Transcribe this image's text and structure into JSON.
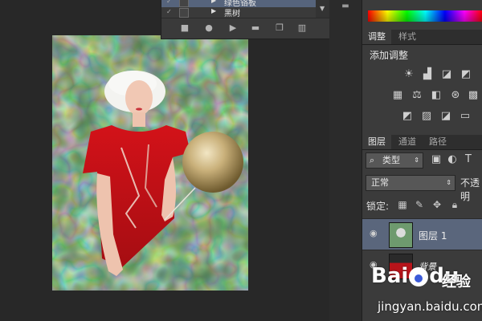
{
  "actions_panel": {
    "rows": [
      {
        "name": "绿色铬板"
      },
      {
        "name": "黑树"
      }
    ]
  },
  "adjustments": {
    "tabs": [
      {
        "label": "调整"
      },
      {
        "label": "样式"
      }
    ],
    "title": "添加调整"
  },
  "layers": {
    "tabs": [
      {
        "label": "图层"
      },
      {
        "label": "通道"
      },
      {
        "label": "路径"
      }
    ],
    "filter_kind": "类型",
    "blend_mode": "正常",
    "opacity_label": "不透明",
    "lock_label": "锁定:",
    "items": [
      {
        "name": "图层 1",
        "selected": true
      },
      {
        "name": "背景",
        "selected": false
      }
    ]
  },
  "watermark": {
    "brand": "Bai",
    "brand_end": "du",
    "name": "经验",
    "url": "jingyan.baidu.com"
  },
  "colors": {
    "selection": "#5a667c",
    "panel_bg": "#3b3b3b",
    "canvas_bg": "#282828"
  }
}
